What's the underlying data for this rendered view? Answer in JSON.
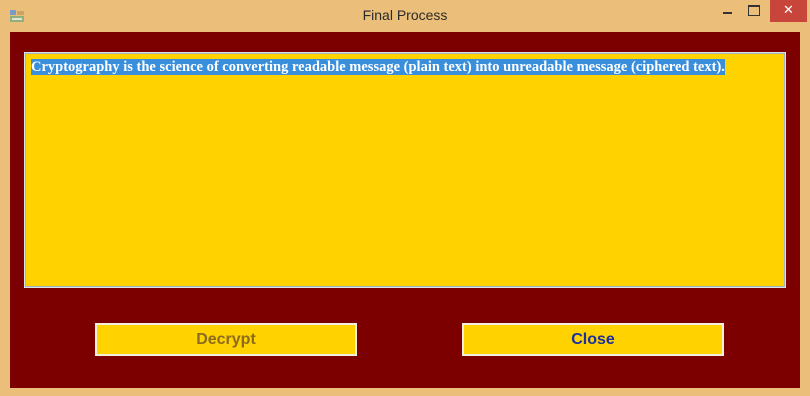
{
  "window": {
    "title": "Final Process",
    "app_icon": "form-icon",
    "controls": {
      "minimize_icon": "minimize-icon",
      "maximize_icon": "maximize-icon",
      "close_icon": "close-icon",
      "close_glyph": "✕"
    }
  },
  "main": {
    "text": "Cryptography is the science of converting readable message (plain text) into unreadable message (ciphered text)."
  },
  "buttons": {
    "decrypt_label": "Decrypt",
    "close_label": "Close"
  },
  "colors": {
    "window_frame": "#ebbf79",
    "client_background": "#7c0000",
    "textbox_background": "#ffd200",
    "selection": "#3a8fdc",
    "close_button": "#c7453b"
  }
}
